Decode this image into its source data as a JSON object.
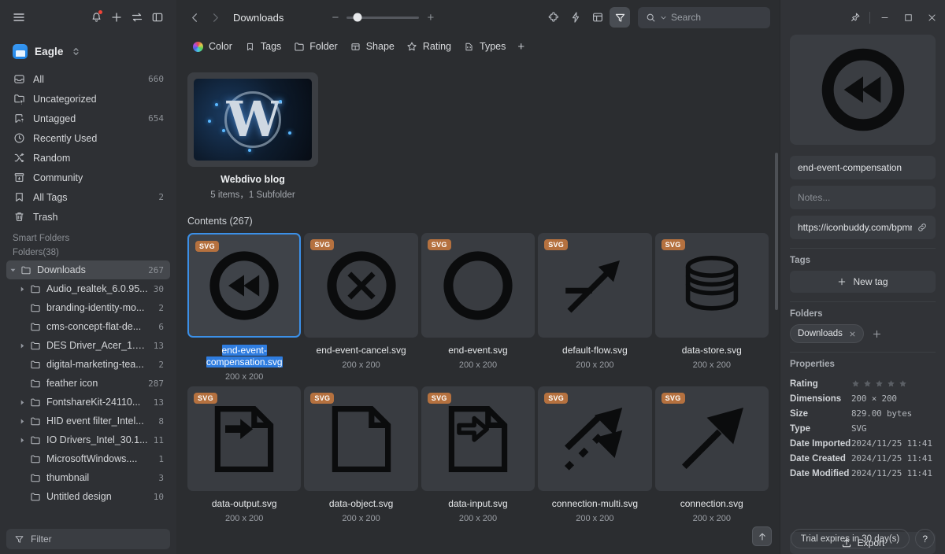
{
  "sidebar": {
    "app_name": "Eagle",
    "nav": [
      {
        "label": "All",
        "count": "660",
        "icon": "inbox-icon"
      },
      {
        "label": "Uncategorized",
        "count": "",
        "icon": "folder-question-icon"
      },
      {
        "label": "Untagged",
        "count": "654",
        "icon": "tag-question-icon"
      },
      {
        "label": "Recently Used",
        "count": "",
        "icon": "clock-icon"
      },
      {
        "label": "Random",
        "count": "",
        "icon": "shuffle-icon"
      },
      {
        "label": "Community",
        "count": "",
        "icon": "archive-icon"
      },
      {
        "label": "All Tags",
        "count": "2",
        "icon": "bookmark-icon"
      },
      {
        "label": "Trash",
        "count": "",
        "icon": "trash-icon"
      }
    ],
    "smart_folders_label": "Smart Folders",
    "folders_label": "Folders(38)",
    "folders": [
      {
        "label": "Downloads",
        "count": "267",
        "expandable": true,
        "expanded": true,
        "active": true,
        "child": false
      },
      {
        "label": "Audio_realtek_6.0.95...",
        "count": "30",
        "expandable": true,
        "expanded": false,
        "active": false,
        "child": true
      },
      {
        "label": "branding-identity-mo...",
        "count": "2",
        "expandable": false,
        "expanded": false,
        "active": false,
        "child": true
      },
      {
        "label": "cms-concept-flat-de...",
        "count": "6",
        "expandable": false,
        "expanded": false,
        "active": false,
        "child": true
      },
      {
        "label": "DES Driver_Acer_1.0....",
        "count": "13",
        "expandable": true,
        "expanded": false,
        "active": false,
        "child": true
      },
      {
        "label": "digital-marketing-tea...",
        "count": "2",
        "expandable": false,
        "expanded": false,
        "active": false,
        "child": true
      },
      {
        "label": "feather icon",
        "count": "287",
        "expandable": false,
        "expanded": false,
        "active": false,
        "child": true
      },
      {
        "label": "FontshareKit-24110...",
        "count": "13",
        "expandable": true,
        "expanded": false,
        "active": false,
        "child": true
      },
      {
        "label": "HID event filter_Intel...",
        "count": "8",
        "expandable": true,
        "expanded": false,
        "active": false,
        "child": true
      },
      {
        "label": "IO Drivers_Intel_30.1...",
        "count": "11",
        "expandable": true,
        "expanded": false,
        "active": false,
        "child": true
      },
      {
        "label": "MicrosoftWindows....",
        "count": "1",
        "expandable": false,
        "expanded": false,
        "active": false,
        "child": true
      },
      {
        "label": "thumbnail",
        "count": "3",
        "expandable": false,
        "expanded": false,
        "active": false,
        "child": true
      },
      {
        "label": "Untitled design",
        "count": "10",
        "expandable": false,
        "expanded": false,
        "active": false,
        "child": true
      }
    ],
    "filter_label": "Filter"
  },
  "topbar": {
    "breadcrumb": "Downloads",
    "zoom_minus": "−",
    "zoom_plus": "+",
    "search_placeholder": "Search",
    "filters": [
      {
        "label": "Color",
        "icon": "color-wheel-icon"
      },
      {
        "label": "Tags",
        "icon": "bookmark-icon"
      },
      {
        "label": "Folder",
        "icon": "folder-icon"
      },
      {
        "label": "Shape",
        "icon": "shape-icon"
      },
      {
        "label": "Rating",
        "icon": "star-icon"
      },
      {
        "label": "Types",
        "icon": "code-icon"
      }
    ],
    "add_filter_label": "+"
  },
  "folder_card": {
    "title": "Webdivo blog",
    "subtitle": "5 items，1 Subfolder",
    "thumb_mark": "W"
  },
  "main": {
    "contents_label": "Contents (267)",
    "items": [
      {
        "name": "end-event-compensation.svg",
        "dimensions": "200 x 200",
        "badge": "SVG",
        "icon": "rewind-circle-icon",
        "selected": true
      },
      {
        "name": "end-event-cancel.svg",
        "dimensions": "200 x 200",
        "badge": "SVG",
        "icon": "x-circle-icon",
        "selected": false
      },
      {
        "name": "end-event.svg",
        "dimensions": "200 x 200",
        "badge": "SVG",
        "icon": "circle-icon",
        "selected": false
      },
      {
        "name": "default-flow.svg",
        "dimensions": "200 x 200",
        "badge": "SVG",
        "icon": "default-flow-arrow-icon",
        "selected": false
      },
      {
        "name": "data-store.svg",
        "dimensions": "200 x 200",
        "badge": "SVG",
        "icon": "database-icon",
        "selected": false
      },
      {
        "name": "data-output.svg",
        "dimensions": "200 x 200",
        "badge": "SVG",
        "icon": "document-arrow-filled-icon",
        "selected": false
      },
      {
        "name": "data-object.svg",
        "dimensions": "200 x 200",
        "badge": "SVG",
        "icon": "document-icon",
        "selected": false
      },
      {
        "name": "data-input.svg",
        "dimensions": "200 x 200",
        "badge": "SVG",
        "icon": "document-arrow-outline-icon",
        "selected": false
      },
      {
        "name": "connection-multi.svg",
        "dimensions": "200 x 200",
        "badge": "SVG",
        "icon": "multi-arrow-icon",
        "selected": false
      },
      {
        "name": "connection.svg",
        "dimensions": "200 x 200",
        "badge": "SVG",
        "icon": "arrow-icon",
        "selected": false
      }
    ]
  },
  "inspector": {
    "title_value": "end-event-compensation",
    "notes_placeholder": "Notes...",
    "url_value": "https://iconbuddy.com/bpmn",
    "tags_header": "Tags",
    "new_tag_label": "New tag",
    "folders_header": "Folders",
    "folder_chip": "Downloads",
    "properties_header": "Properties",
    "properties": [
      {
        "key": "Rating",
        "value": "",
        "stars": 5
      },
      {
        "key": "Dimensions",
        "value": "200 × 200"
      },
      {
        "key": "Size",
        "value": "829.00 bytes"
      },
      {
        "key": "Type",
        "value": "SVG"
      },
      {
        "key": "Date Imported",
        "value": "2024/11/25 11:41"
      },
      {
        "key": "Date Created",
        "value": "2024/11/25 11:41"
      },
      {
        "key": "Date Modified",
        "value": "2024/11/25 11:41"
      }
    ],
    "export_label": "Export",
    "trial_label": "Trial expires in 30 day(s)",
    "help_label": "?"
  },
  "colors": {
    "accent": "#3b90e8",
    "selection": "#2f7de0",
    "badge": "#b5713f",
    "notification": "#f04438",
    "sidebar_bg": "#2e3034",
    "main_bg": "#2b2d30",
    "inspector_bg": "#313337"
  }
}
